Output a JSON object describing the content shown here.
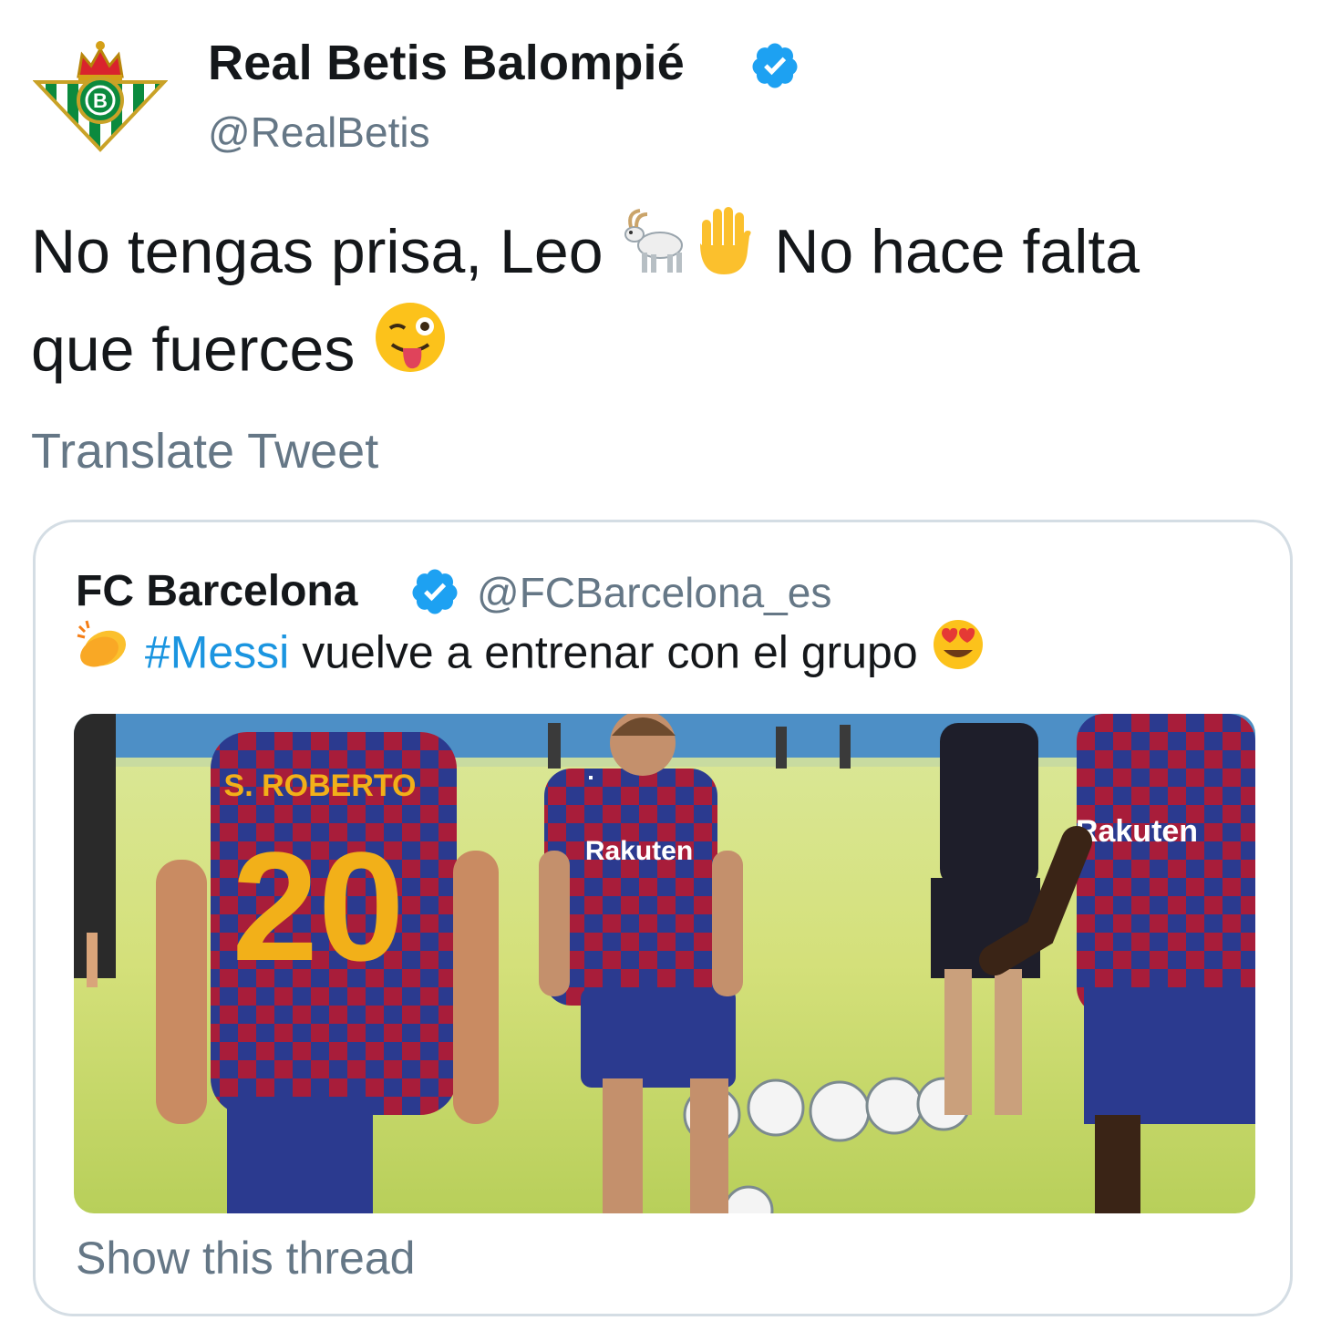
{
  "tweet": {
    "display_name": "Real Betis Balompié",
    "handle": "@RealBetis",
    "verified": true,
    "text_line1_a": "No tengas prisa, Leo",
    "text_line1_b": "No hace falta",
    "text_line2": "que fuerces",
    "emojis": [
      "goat-emoji",
      "raised-hand-emoji",
      "winking-face-with-tongue-emoji"
    ],
    "translate_label": "Translate Tweet"
  },
  "quoted_tweet": {
    "display_name": "FC Barcelona",
    "handle": "@FCBarcelona_es",
    "verified": true,
    "hashtag": "#Messi",
    "text": "vuelve a entrenar con el grupo",
    "emojis": [
      "clapping-hands-emoji",
      "heart-eyes-emoji"
    ],
    "media_alt": "",
    "show_thread_label": "Show this thread"
  },
  "colors": {
    "text_primary": "#14171a",
    "text_secondary": "#657786",
    "link_blue": "#1b95e0",
    "verified_blue": "#1da1f2",
    "card_border": "#d4dde4"
  }
}
